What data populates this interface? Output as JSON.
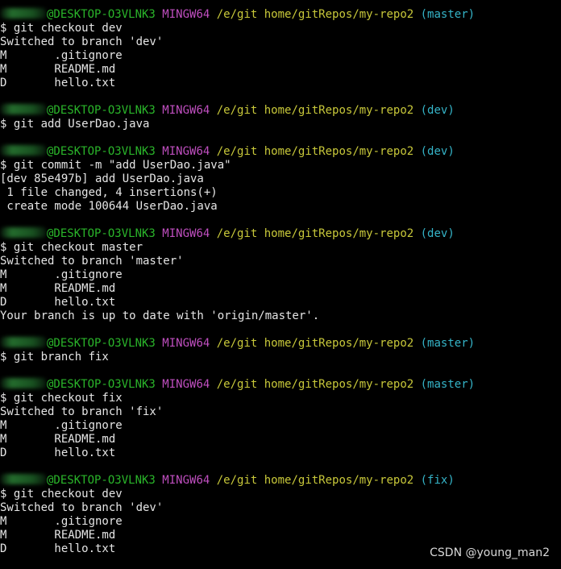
{
  "colors": {
    "background": "#000000",
    "text": "#e5e5e5",
    "host": "#2ab52a",
    "system": "#c04fc0",
    "path": "#c8c83a",
    "branch": "#35b4c8"
  },
  "prompt": {
    "host": "@DESKTOP-O3VLNK3",
    "system": "MINGW64",
    "path": "/e/git home/gitRepos/my-repo2"
  },
  "blocks": [
    {
      "branch": "(master)",
      "command": "$ git checkout dev",
      "output": [
        "Switched to branch 'dev'",
        "M       .gitignore",
        "M       README.md",
        "D       hello.txt"
      ]
    },
    {
      "branch": "(dev)",
      "command": "$ git add UserDao.java",
      "output": []
    },
    {
      "branch": "(dev)",
      "command": "$ git commit -m \"add UserDao.java\"",
      "output": [
        "[dev 85e497b] add UserDao.java",
        " 1 file changed, 4 insertions(+)",
        " create mode 100644 UserDao.java"
      ]
    },
    {
      "branch": "(dev)",
      "command": "$ git checkout master",
      "output": [
        "Switched to branch 'master'",
        "M       .gitignore",
        "M       README.md",
        "D       hello.txt",
        "Your branch is up to date with 'origin/master'."
      ]
    },
    {
      "branch": "(master)",
      "command": "$ git branch fix",
      "output": []
    },
    {
      "branch": "(master)",
      "command": "$ git checkout fix",
      "output": [
        "Switched to branch 'fix'",
        "M       .gitignore",
        "M       README.md",
        "D       hello.txt"
      ]
    },
    {
      "branch": "(fix)",
      "command": "$ git checkout dev",
      "output": [
        "Switched to branch 'dev'",
        "M       .gitignore",
        "M       README.md",
        "D       hello.txt"
      ]
    }
  ],
  "watermark": "CSDN @young_man2"
}
